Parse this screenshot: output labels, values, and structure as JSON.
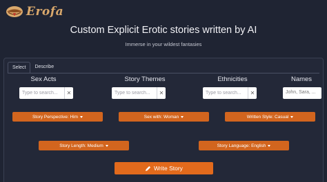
{
  "brand": {
    "name": "Erofa",
    "logo_icon": "lips-logo-icon"
  },
  "hero": {
    "title": "Custom Explicit Erotic stories written by AI",
    "subtitle": "Immerse in your wildest fantasies"
  },
  "tabs": [
    {
      "label": "Select",
      "active": true
    },
    {
      "label": "Describe",
      "active": false
    }
  ],
  "columns": [
    {
      "title": "Sex Acts",
      "placeholder": "Type to search..."
    },
    {
      "title": "Story Themes",
      "placeholder": "Type to search..."
    },
    {
      "title": "Ethnicities",
      "placeholder": "Type to search..."
    },
    {
      "title": "Names",
      "placeholder": "John, Sara, ..."
    }
  ],
  "clear_glyph": "✕",
  "dropdowns": {
    "perspective": "Story Perspective: Him",
    "sex_with": "Sex with: Woman",
    "written_style": "Written Style: Casual",
    "length": "Story Length: Medium",
    "language": "Story Language: English"
  },
  "write_button": {
    "label": "Write Story",
    "icon": "pen-icon"
  },
  "colors": {
    "background": "#1f2433",
    "accent": "#d2651e",
    "brand": "#d9a86c"
  }
}
